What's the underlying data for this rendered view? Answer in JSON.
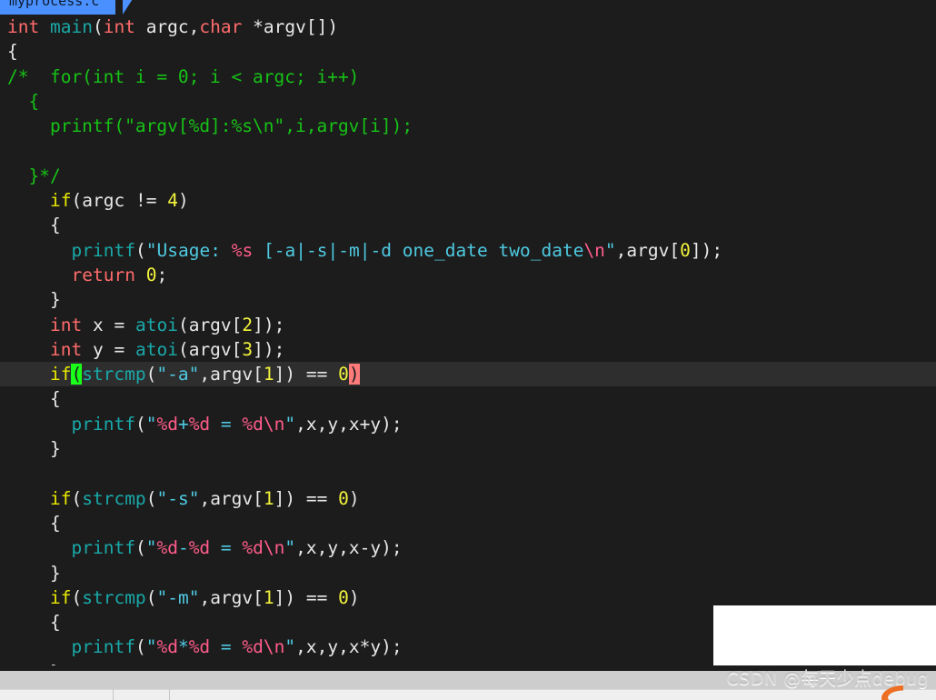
{
  "window": {
    "title": "myprocess.c",
    "background_color": "#1c1c1c"
  },
  "tabs": {
    "active_label": "myprocess.c"
  },
  "theme": {
    "editor_bg": "#1c1c1c",
    "current_line_bg": "#2e2e2e",
    "default_text": "#e8e8e8",
    "keyword": "#ff6b6b",
    "function": "#1aa8a8",
    "control": "#e8e800",
    "number": "#f2f23d",
    "string": "#4ec9e0",
    "format_spec": "#ff5c8a",
    "comment": "#17c217",
    "cursor_bracket_bg": "#19ff19",
    "match_bracket_bg": "#ff7a7a",
    "tab_active_bg": "#4a90ff"
  },
  "code": {
    "language": "C",
    "lines": [
      "int main(int argc,char *argv[])",
      "{",
      "/*  for(int i = 0; i < argc; i++)",
      "  {",
      "    printf(\"argv[%d]:%s\\n\",i,argv[i]);",
      "",
      "  }*/",
      "    if(argc != 4)",
      "    {",
      "      printf(\"Usage: %s [-a|-s|-m|-d one_date two_date\\n\",argv[0]);",
      "      return 0;",
      "    }",
      "    int x = atoi(argv[2]);",
      "    int y = atoi(argv[3]);",
      "    if(strcmp(\"-a\",argv[1]) == 0)",
      "    {",
      "      printf(\"%d+%d = %d\\n\",x,y,x+y);",
      "    }",
      "",
      "    if(strcmp(\"-s\",argv[1]) == 0)",
      "    {",
      "      printf(\"%d-%d = %d\\n\",x,y,x-y);",
      "    }",
      "    if(strcmp(\"-m\",argv[1]) == 0)",
      "    {",
      "      printf(\"%d*%d = %d\\n\",x,y,x*y);",
      "    }"
    ],
    "highlighted_line_index": 14,
    "highlighted_line_text": "    if(strcmp(\"-a\",argv[1]) == 0)",
    "cursor_bracket": "(",
    "matching_bracket": ")"
  },
  "watermark": {
    "text": "CSDN @每天少点debug",
    "logo": "csdn-logo"
  }
}
